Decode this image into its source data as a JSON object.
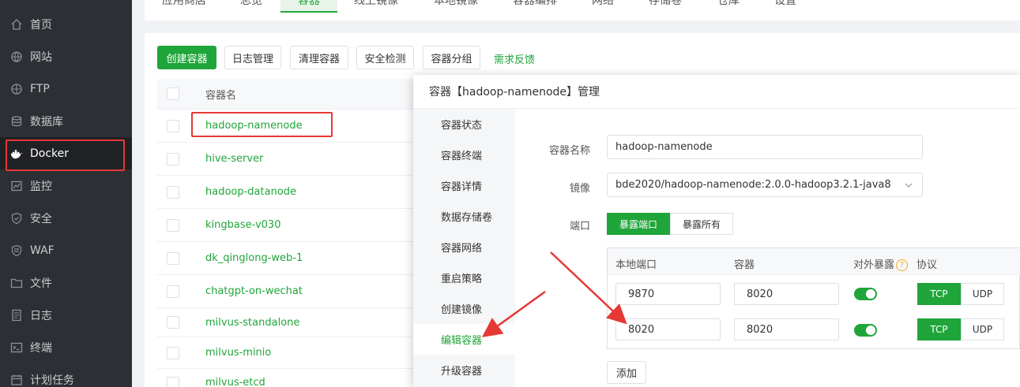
{
  "sidebar": {
    "items": [
      {
        "label": "首页",
        "icon": "home-icon"
      },
      {
        "label": "网站",
        "icon": "globe-icon"
      },
      {
        "label": "FTP",
        "icon": "ftp-icon"
      },
      {
        "label": "数据库",
        "icon": "database-icon"
      },
      {
        "label": "Docker",
        "icon": "docker-icon"
      },
      {
        "label": "监控",
        "icon": "monitor-icon"
      },
      {
        "label": "安全",
        "icon": "shield-icon"
      },
      {
        "label": "WAF",
        "icon": "waf-shield-icon"
      },
      {
        "label": "文件",
        "icon": "folder-icon"
      },
      {
        "label": "日志",
        "icon": "log-icon"
      },
      {
        "label": "终端",
        "icon": "terminal-icon"
      },
      {
        "label": "计划任务",
        "icon": "calendar-icon"
      }
    ]
  },
  "tabs": [
    "应用商店",
    "总览",
    "容器",
    "线上镜像",
    "本地镜像",
    "容器编排",
    "网络",
    "存储卷",
    "仓库",
    "设置"
  ],
  "toolbar": {
    "create": "创建容器",
    "logs": "日志管理",
    "clean": "清理容器",
    "security": "安全检测",
    "group": "容器分组",
    "feedback": "需求反馈"
  },
  "table": {
    "header": "容器名",
    "rows": [
      "hadoop-namenode",
      "hive-server",
      "hadoop-datanode",
      "kingbase-v030",
      "dk_qinglong-web-1",
      "chatgpt-on-wechat",
      "milvus-standalone",
      "milvus-minio",
      "milvus-etcd"
    ]
  },
  "modal": {
    "title": "容器【hadoop-namenode】管理",
    "nav": [
      "容器状态",
      "容器终端",
      "容器详情",
      "数据存储卷",
      "容器网络",
      "重启策略",
      "创建镜像",
      "编辑容器",
      "升级容器"
    ],
    "form": {
      "name_label": "容器名称",
      "name_value": "hadoop-namenode",
      "image_label": "镜像",
      "image_value": "bde2020/hadoop-namenode:2.0.0-hadoop3.2.1-java8",
      "port_label": "端口",
      "port_mode_expose": "暴露端口",
      "port_mode_all": "暴露所有"
    },
    "ports": {
      "headers": {
        "local": "本地端口",
        "container": "容器",
        "public": "对外暴露",
        "help": "?",
        "protocol": "协议"
      },
      "rows": [
        {
          "local": "9870",
          "container": "8020",
          "protocol": "TCP"
        },
        {
          "local": "8020",
          "container": "8020",
          "protocol": "TCP"
        }
      ],
      "tcp": "TCP",
      "udp": "UDP"
    },
    "add": "添加"
  },
  "colors": {
    "accent": "#20a53a",
    "annotation": "#e53935",
    "sidebar": "#2c2f33"
  }
}
